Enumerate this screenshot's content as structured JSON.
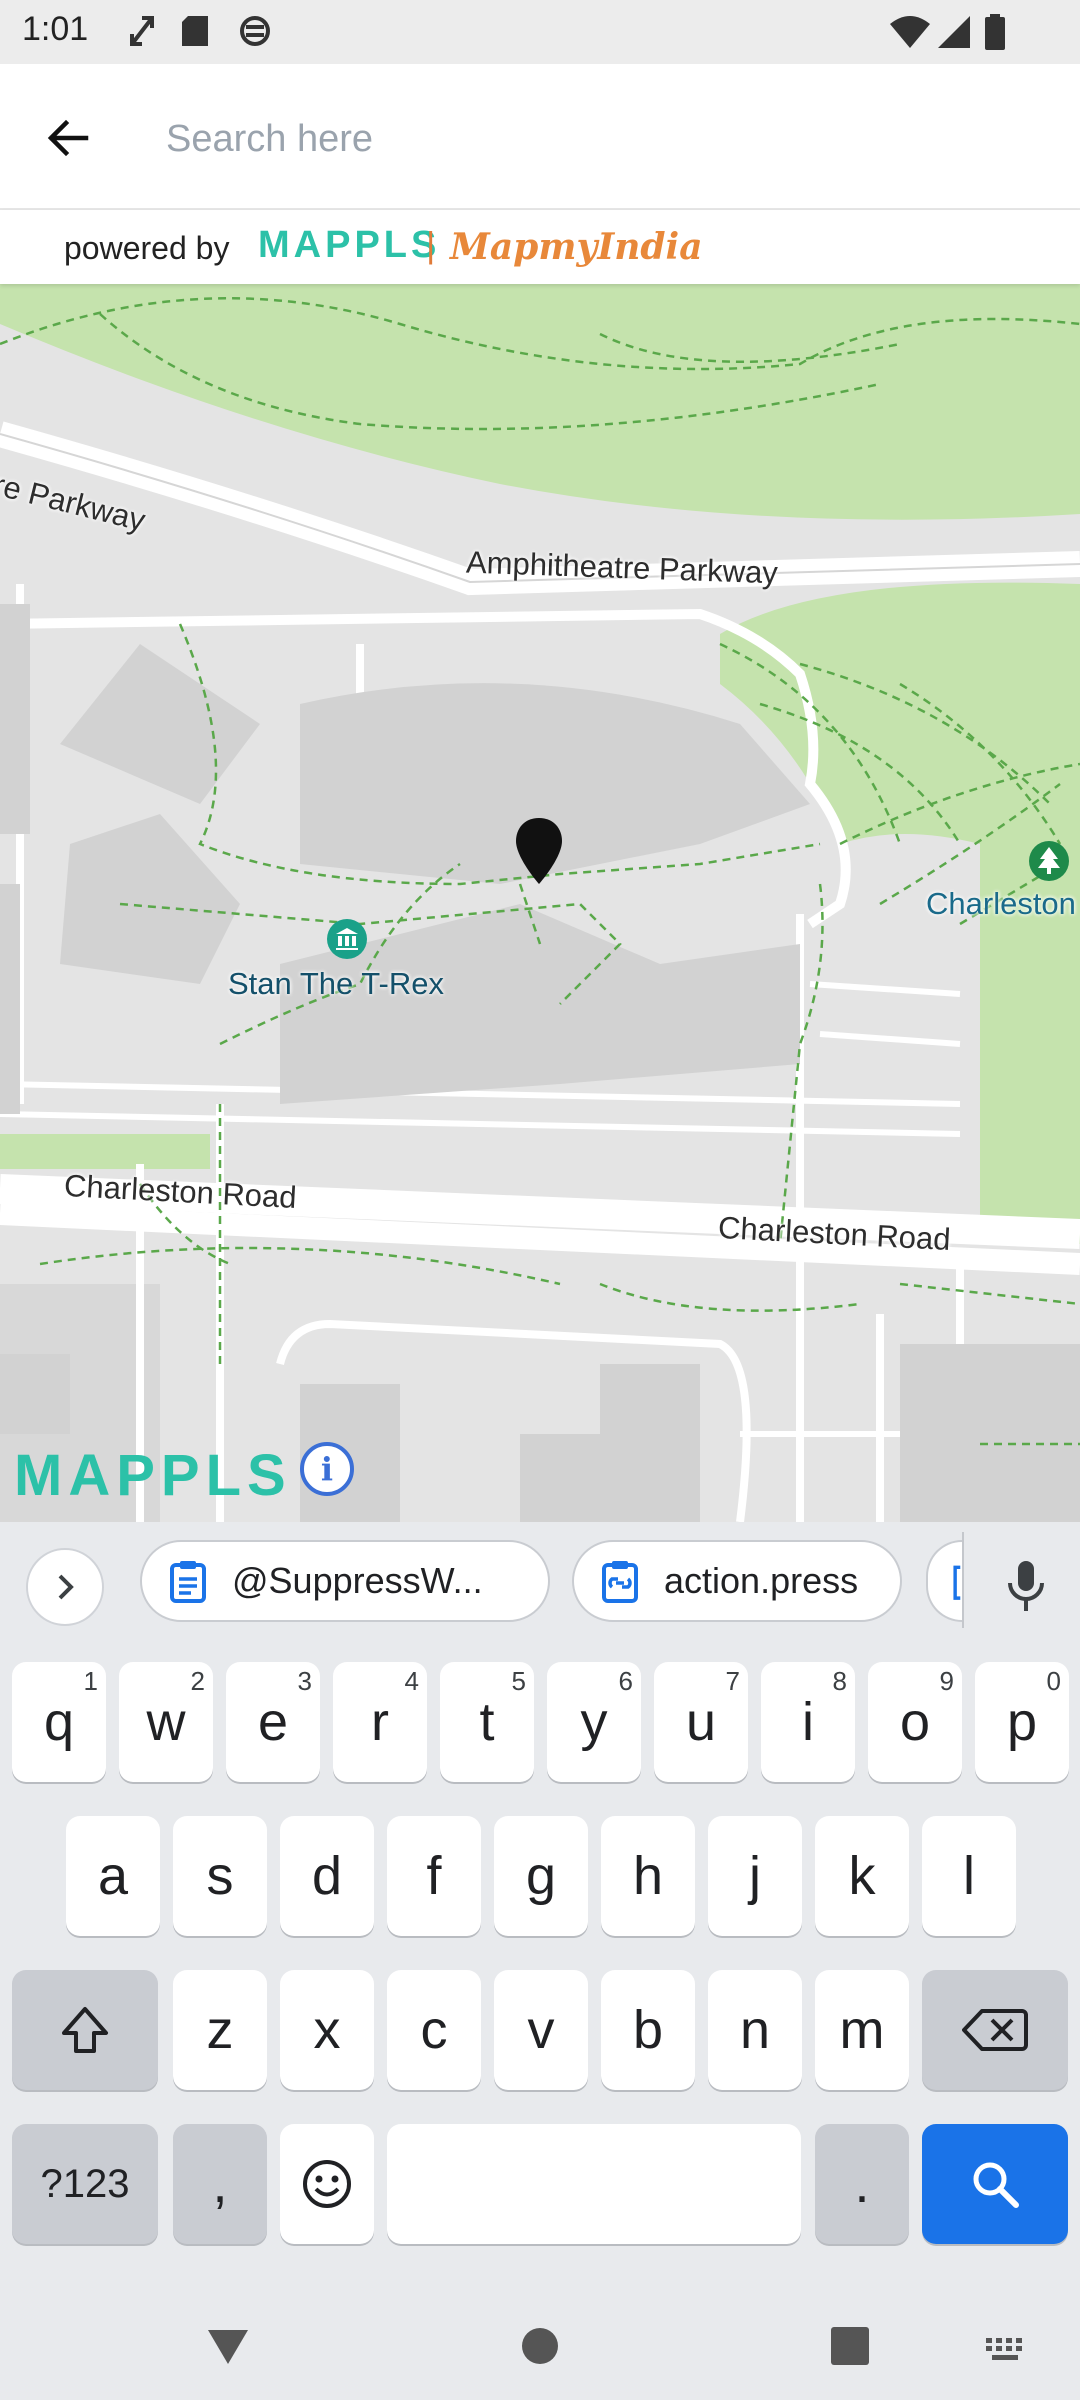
{
  "status_bar": {
    "time": "1:01"
  },
  "search": {
    "placeholder": "Search here"
  },
  "powered_by": {
    "text": "powered by",
    "brand_primary": "MAPPLS",
    "separator": "|",
    "brand_secondary": "MapmyIndia"
  },
  "map": {
    "road_labels": [
      "re Parkway",
      "Amphitheatre Parkway",
      "Charleston Road",
      "Charleston Road"
    ],
    "poi_labels": [
      "Stan The T-Rex",
      "Charleston"
    ],
    "logo": "MAPPLS",
    "info": "i"
  },
  "keyboard": {
    "suggestions": [
      "@SuppressW...",
      "action.press"
    ],
    "row1": [
      {
        "key": "q",
        "hint": "1"
      },
      {
        "key": "w",
        "hint": "2"
      },
      {
        "key": "e",
        "hint": "3"
      },
      {
        "key": "r",
        "hint": "4"
      },
      {
        "key": "t",
        "hint": "5"
      },
      {
        "key": "y",
        "hint": "6"
      },
      {
        "key": "u",
        "hint": "7"
      },
      {
        "key": "i",
        "hint": "8"
      },
      {
        "key": "o",
        "hint": "9"
      },
      {
        "key": "p",
        "hint": "0"
      }
    ],
    "row2": [
      "a",
      "s",
      "d",
      "f",
      "g",
      "h",
      "j",
      "k",
      "l"
    ],
    "row3": [
      "z",
      "x",
      "c",
      "v",
      "b",
      "n",
      "m"
    ],
    "symbols_label": "?123",
    "comma": ",",
    "period": "."
  },
  "colors": {
    "park": "#c5e3ad",
    "accent": "#1a73e8",
    "mappls": "#2cc1a8",
    "path": "#5aa84a"
  }
}
